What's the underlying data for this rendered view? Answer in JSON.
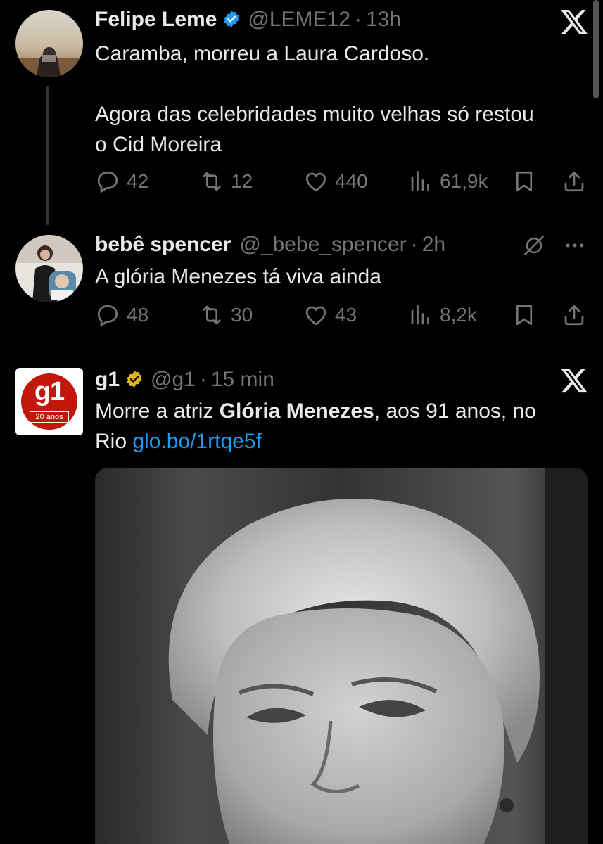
{
  "tweet1": {
    "name": "Felipe Leme",
    "handle": "@LEME12",
    "separator": "·",
    "time": "13h",
    "text_line1": "Caramba, morreu a Laura Cardoso.",
    "text_line2": "Agora das celebridades muito velhas só restou",
    "text_line3": "o Cid Moreira",
    "replies": "42",
    "retweets": "12",
    "likes": "440",
    "views": "61,9k"
  },
  "tweet2": {
    "name": "bebê spencer",
    "handle": "@_bebe_spencer",
    "separator": "·",
    "time": "2h",
    "text": "A glória Menezes tá viva ainda",
    "replies": "48",
    "retweets": "30",
    "likes": "43",
    "views": "8,2k"
  },
  "tweet3": {
    "name": "g1",
    "handle": "@g1",
    "separator": "·",
    "time": "15 min",
    "text_prefix": "Morre a atriz ",
    "text_bold": "Glória Menezes",
    "text_suffix": ", aos 91 anos, no",
    "text_line2": "Rio ",
    "link": "glo.bo/1rtqe5f",
    "avatar_logo": "g1",
    "avatar_sub": "20 anos"
  },
  "colors": {
    "background": "#000000",
    "text": "#e7e9ea",
    "muted": "#71767b",
    "link": "#1d9bf0",
    "verified_blue": "#1d9bf0",
    "verified_gold": "#e2b719",
    "g1_red": "#c4170c"
  },
  "icons": [
    "x-logo-icon",
    "verified-badge-icon",
    "reply-icon",
    "retweet-icon",
    "like-icon",
    "views-icon",
    "bookmark-icon",
    "share-icon",
    "grok-icon",
    "more-icon"
  ]
}
